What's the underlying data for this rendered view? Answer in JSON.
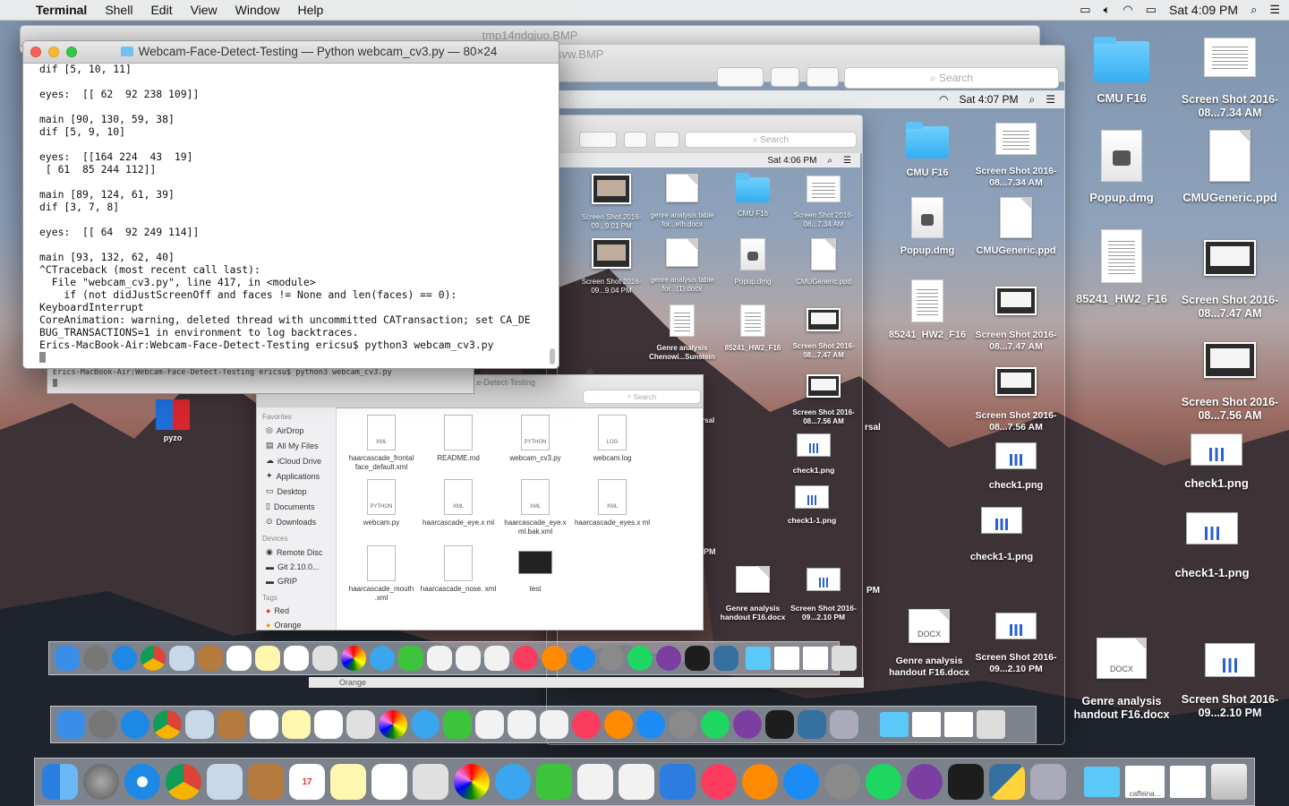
{
  "menubar": {
    "app": "Terminal",
    "items": [
      "Shell",
      "Edit",
      "View",
      "Window",
      "Help"
    ],
    "clock": "Sat 4:09 PM"
  },
  "terminal": {
    "title": "Webcam-Face-Detect-Testing — Python webcam_cv3.py — 80×24",
    "lines": [
      "dif [5, 10, 11]",
      "",
      "eyes:  [[ 62  92 238 109]]",
      "",
      "main [90, 130, 59, 38]",
      "dif [5, 9, 10]",
      "",
      "eyes:  [[164 224  43  19]",
      " [ 61  85 244 112]]",
      "",
      "main [89, 124, 61, 39]",
      "dif [3, 7, 8]",
      "",
      "eyes:  [[ 64  92 249 114]]",
      "",
      "main [93, 132, 62, 40]",
      "^CTraceback (most recent call last):",
      "  File \"webcam_cv3.py\", line 417, in <module>",
      "    if (not didJustScreenOff and faces != None and len(faces) == 0):",
      "KeyboardInterrupt",
      "CoreAnimation: warning, deleted thread with uncommitted CATransaction; set CA_DE",
      "BUG_TRANSACTIONS=1 in environment to log backtraces.",
      "Erics-MacBook-Air:Webcam-Face-Detect-Testing ericsu$ python3 webcam_cv3.py"
    ]
  },
  "terminal_behind": {
    "prompt": "Erics-MacBook-Air:Webcam-Face-Detect-Testing ericsu$ python3 webcam_cv3.py"
  },
  "back_windows": {
    "title1": "tmp14ndqjuo.BMP",
    "title2": "svw.BMP",
    "search": "Search",
    "clock2": "Sat 4:07 PM",
    "clock3": "Sat 4:06 PM"
  },
  "desktop_icons": {
    "col1": [
      {
        "label": "CMU F16",
        "type": "folder"
      },
      {
        "label": "Popup.dmg",
        "type": "dmg"
      },
      {
        "label": "85241_HW2_F16",
        "type": "textdoc"
      },
      {
        "label": "Genre analysis handout F16.docx",
        "type": "docx"
      }
    ],
    "col2": [
      {
        "label": "Screen Shot 2016-08...7.34 AM",
        "type": "textdoc"
      },
      {
        "label": "CMUGeneric.ppd",
        "type": "doc"
      },
      {
        "label": "Screen Shot 2016-08...7.47 AM",
        "type": "thumb"
      },
      {
        "label": "Screen Shot 2016-08...7.56 AM",
        "type": "thumb"
      },
      {
        "label": "check1.png",
        "type": "chart"
      },
      {
        "label": "check1-1.png",
        "type": "chart"
      },
      {
        "label": "Screen Shot 2016-09...2.10 PM",
        "type": "thumb"
      }
    ]
  },
  "layer2_icons": [
    {
      "label": "CMU F16"
    },
    {
      "label": "Screen Shot 2016-08...7.34 AM"
    },
    {
      "label": "Popup.dmg"
    },
    {
      "label": "CMUGeneric.ppd"
    },
    {
      "label": "85241_HW2_F16"
    },
    {
      "label": "Screen Shot 2016-08...7.47 AM"
    },
    {
      "label": "Screen Shot 2016-08...7.56 AM"
    },
    {
      "label": "check1.png"
    },
    {
      "label": "check1-1.png"
    },
    {
      "label": "Genre analysis handout F16.docx"
    },
    {
      "label": "Screen Shot 2016-09...2.10 PM"
    }
  ],
  "layer3_icons": [
    {
      "label": "Screen Shot 2016-09...9.01 PM"
    },
    {
      "label": "genre analysis table for...eth.docx"
    },
    {
      "label": "CMU F16"
    },
    {
      "label": "Screen Shot 2016-08...7.34 AM"
    },
    {
      "label": "Screen Shot 2016-09...9.04 PM"
    },
    {
      "label": "genre analysis table for...(1).docx"
    },
    {
      "label": "Popup.dmg"
    },
    {
      "label": "CMUGeneric.ppd"
    },
    {
      "label": "Genre analysis Chenowi...Sunstein"
    },
    {
      "label": "85241_HW2_F16"
    },
    {
      "label": "Screen Shot 2016-08...7.47 AM"
    },
    {
      "label": "Screen Shot 2016-08...7.56 AM"
    },
    {
      "label": "check1.png"
    },
    {
      "label": "check1-1.png"
    },
    {
      "label": "Genre analysis handout F16.docx"
    },
    {
      "label": "Screen Shot 2016-09...2.10 PM"
    }
  ],
  "finder": {
    "title": "...e-Detect-Testing",
    "search": "Search",
    "favorites_header": "Favorites",
    "favorites": [
      "AirDrop",
      "All My Files",
      "iCloud Drive",
      "Applications",
      "Desktop",
      "Documents",
      "Downloads"
    ],
    "devices_header": "Devices",
    "devices": [
      "Remote Disc",
      "Git 2.10.0...",
      "GRIP"
    ],
    "tags_header": "Tags",
    "tags": [
      "Red",
      "Orange"
    ],
    "files": [
      {
        "name": "haarcascade_frontal face_default.xml",
        "badge": "XML"
      },
      {
        "name": "README.md",
        "badge": ""
      },
      {
        "name": "webcam_cv3.py",
        "badge": "PYTHON"
      },
      {
        "name": "webcam.log",
        "badge": "LOG"
      },
      {
        "name": "webcam.py",
        "badge": "PYTHON"
      },
      {
        "name": "haarcascade_eye.x ml",
        "badge": "XML"
      },
      {
        "name": "haarcascade_eye.x ml.bak.xml",
        "badge": "XML"
      },
      {
        "name": "haarcascade_eyes.x ml",
        "badge": "XML"
      },
      {
        "name": "haarcascade_mouth .xml",
        "badge": ""
      },
      {
        "name": "haarcascade_nose. xml",
        "badge": ""
      },
      {
        "name": "test",
        "badge": ""
      }
    ]
  },
  "pyzo_label": "pyzo",
  "dock_labels": {
    "caffeine": "caffeina..."
  },
  "other_labels": {
    "orange": "Orange",
    "docx": "DOCX",
    "pm": "PM",
    "rsal": "rsal"
  },
  "colors": {
    "close": "#fc5f57",
    "minimize": "#fdbc2e",
    "zoom": "#33c748",
    "folder": "#48b8f5"
  }
}
